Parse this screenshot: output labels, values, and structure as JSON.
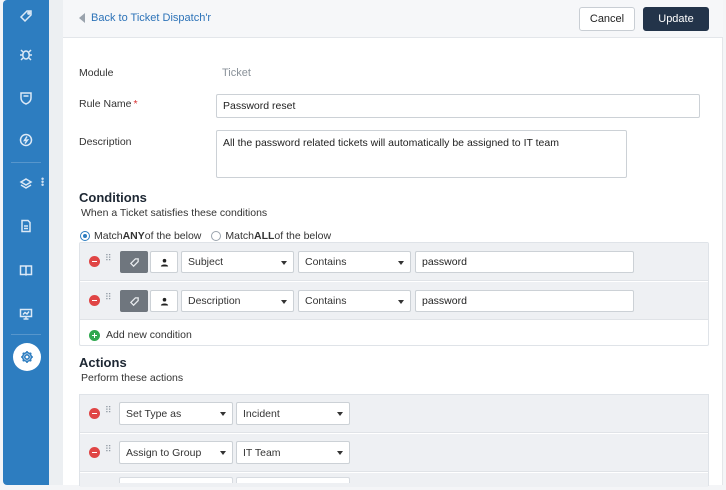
{
  "header": {
    "back_label": "Back to Ticket Dispatch'r",
    "cancel_label": "Cancel",
    "update_label": "Update"
  },
  "form": {
    "module_label": "Module",
    "module_value": "Ticket",
    "rule_name_label": "Rule Name",
    "rule_name_required": "*",
    "rule_name_value": "Password reset",
    "description_label": "Description",
    "description_value": "All the password related tickets will automatically be assigned to IT team"
  },
  "conditions": {
    "title": "Conditions",
    "subtitle": "When a Ticket satisfies these conditions",
    "match_any_prefix": "Match ",
    "match_any_bold": "ANY",
    "match_any_suffix": " of the below",
    "match_all_prefix": "Match ",
    "match_all_bold": "ALL",
    "match_all_suffix": " of the below",
    "selected_match": "ANY",
    "rows": [
      {
        "field": "Subject",
        "operator": "Contains",
        "value": "password"
      },
      {
        "field": "Description",
        "operator": "Contains",
        "value": "password"
      }
    ],
    "add_label": "Add new condition"
  },
  "actions": {
    "title": "Actions",
    "subtitle": "Perform these actions",
    "rows": [
      {
        "action": "Set Type as",
        "value": "Incident"
      },
      {
        "action": "Assign to Group",
        "value": "IT Team"
      }
    ]
  },
  "sidebar": {
    "icons": [
      "tag-icon",
      "bug-icon",
      "shield-icon",
      "speed-icon",
      "layers-icon",
      "report-icon",
      "book-icon",
      "monitor-icon",
      "settings-icon"
    ],
    "active": "settings-icon"
  },
  "colors": {
    "sidebar": "#2d7dc0",
    "primary_button": "#23344a",
    "link": "#2d73b8",
    "remove": "#e04545",
    "add": "#2fa84f"
  }
}
